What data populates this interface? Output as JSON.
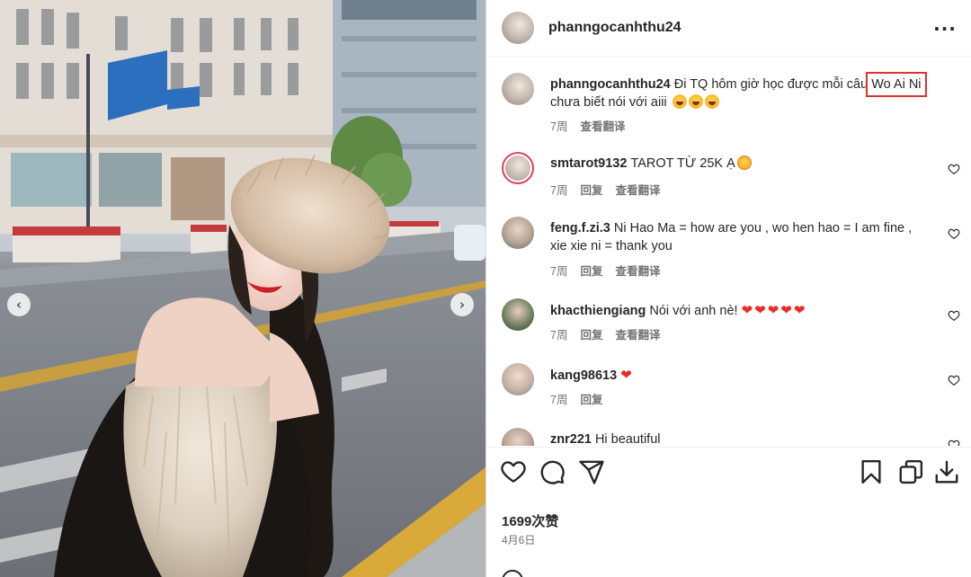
{
  "post": {
    "username": "phanngocanhthu24",
    "more_icon": "more-horizontal-icon"
  },
  "caption": {
    "username": "phanngocanhthu24",
    "text_before": "Đi TQ hôm giờ học được mỗi câu ",
    "highlighted": "Wo Ai Ni",
    "text_after": "chưa biết nói với aiii",
    "emojis": [
      "grinning-tongue-emoji",
      "grinning-tongue-emoji",
      "grinning-tongue-emoji"
    ],
    "time": "7周",
    "translate": "查看翻译"
  },
  "comments": [
    {
      "username": "smtarot9132",
      "text": "TAROT TỪ 25K Ạ",
      "emoji": "heart-eyes-emoji",
      "time": "7周",
      "reply": "回复",
      "translate": "查看翻译"
    },
    {
      "username": "feng.f.zi.3",
      "text": "Ni Hao Ma = how are you , wo hen hao = I am fine ,",
      "text2": "xie xie ni = thank you",
      "time": "7周",
      "reply": "回复",
      "translate": "查看翻译"
    },
    {
      "username": "khacthiengiang",
      "text": "Nói với anh nè!",
      "hearts": "❤❤❤❤❤",
      "time": "7周",
      "reply": "回复",
      "translate": "查看翻译"
    },
    {
      "username": "kang98613",
      "text": "",
      "hearts": "❤",
      "time": "7周",
      "reply": "回复"
    },
    {
      "username": "znr221",
      "text": "Hi beautiful"
    }
  ],
  "actions": {
    "icons": [
      "heart-icon",
      "comment-icon",
      "share-icon",
      "bookmark-icon",
      "copy-icon",
      "download-icon"
    ]
  },
  "likes": "1699次赞",
  "date": "4月6日",
  "colors": {
    "highlight_box": "#e0322c",
    "text": "#262626",
    "meta": "#737373",
    "heart_red": "#ed2a2a"
  }
}
